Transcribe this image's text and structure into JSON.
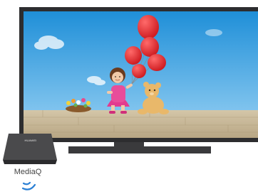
{
  "device": {
    "label": "MediaQ",
    "brand_logo_text": "HUAWEI",
    "body_color": "#2b2b2d",
    "top_color": "#4a4a4c"
  },
  "tv": {
    "bezel_color": "#2d2d2f",
    "stand_color": "#3a3a3c"
  },
  "scene": {
    "sky_top": "#1f8fd8",
    "sky_bottom": "#9ad2f4",
    "wall_color": "#c9b89a",
    "balloon_color": "#e6262b"
  },
  "signal": {
    "icon": "wireless-signal-icon",
    "color": "#2a7fd4"
  }
}
